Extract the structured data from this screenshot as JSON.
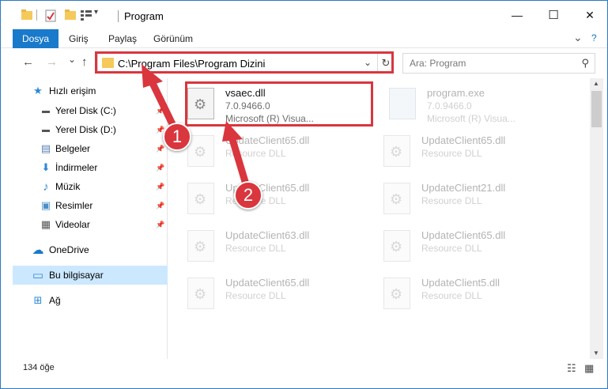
{
  "window": {
    "title": "Program",
    "minimize": "—",
    "maximize": "☐",
    "close": "✕"
  },
  "ribbon": {
    "tabs": [
      "Dosya",
      "Giriş",
      "Paylaş",
      "Görünüm"
    ],
    "expand": "⌄",
    "help": "?"
  },
  "nav": {
    "back": "←",
    "forward": "→",
    "recent": "⌄",
    "up": "↑",
    "path": "C:\\Program Files\\Program Dizini",
    "dropdown": "⌄",
    "refresh": "↻",
    "search_placeholder": "Ara: Program",
    "search_icon": "⚲"
  },
  "sidebar": {
    "items": [
      {
        "label": "Hızlı erişim",
        "icon": "★",
        "color": "#2b88d8"
      },
      {
        "label": "Yerel Disk (C:)",
        "icon": "▬",
        "color": "#555555",
        "pinned": true
      },
      {
        "label": "Yerel Disk (D:)",
        "icon": "▬",
        "color": "#555555",
        "pinned": true
      },
      {
        "label": "Belgeler",
        "icon": "▤",
        "color": "#5a7fb5",
        "pinned": true
      },
      {
        "label": "İndirmeler",
        "icon": "⬇",
        "color": "#2b88d8",
        "pinned": true
      },
      {
        "label": "Müzik",
        "icon": "♪",
        "color": "#2b88d8",
        "pinned": true
      },
      {
        "label": "Resimler",
        "icon": "▣",
        "color": "#4a8fc8",
        "pinned": true
      },
      {
        "label": "Videolar",
        "icon": "▦",
        "color": "#555555",
        "pinned": true
      },
      {
        "label": "OneDrive",
        "icon": "☁",
        "color": "#1979ca"
      },
      {
        "label": "Bu bilgisayar",
        "icon": "▭",
        "color": "#3b8ad6"
      },
      {
        "label": "Ağ",
        "icon": "⊞",
        "color": "#2b88d8"
      }
    ],
    "pin_glyph": "📌"
  },
  "files": [
    {
      "name": "vsaec.dll",
      "line2": "7.0.9466.0",
      "line3": "Microsoft (R) Visua..."
    },
    {
      "name": "program.exe",
      "line2": "7.0.9466.0",
      "line3": "Microsoft (R) Visua..."
    },
    {
      "name": "UpdateClient65.dll",
      "line2": "Resource DLL"
    },
    {
      "name": "UpdateClient65.dll",
      "line2": "Resource DLL"
    },
    {
      "name": "UpdateClient65.dll",
      "line2": "Resource DLL"
    },
    {
      "name": "UpdateClient21.dll",
      "line2": "Resource DLL"
    },
    {
      "name": "UpdateClient63.dll",
      "line2": "Resource DLL"
    },
    {
      "name": "UpdateClient65.dll",
      "line2": "Resource DLL"
    },
    {
      "name": "UpdateClient65.dll",
      "line2": "Resource DLL"
    },
    {
      "name": "UpdateClient5.dll",
      "line2": "Resource DLL"
    }
  ],
  "status": {
    "count": "134 öğe"
  },
  "annotations": {
    "step1": "1",
    "step2": "2",
    "color": "#d9363e"
  },
  "scrollbar": {
    "up": "▲",
    "down": "▼"
  },
  "views": {
    "details": "☷",
    "tiles": "▦"
  }
}
